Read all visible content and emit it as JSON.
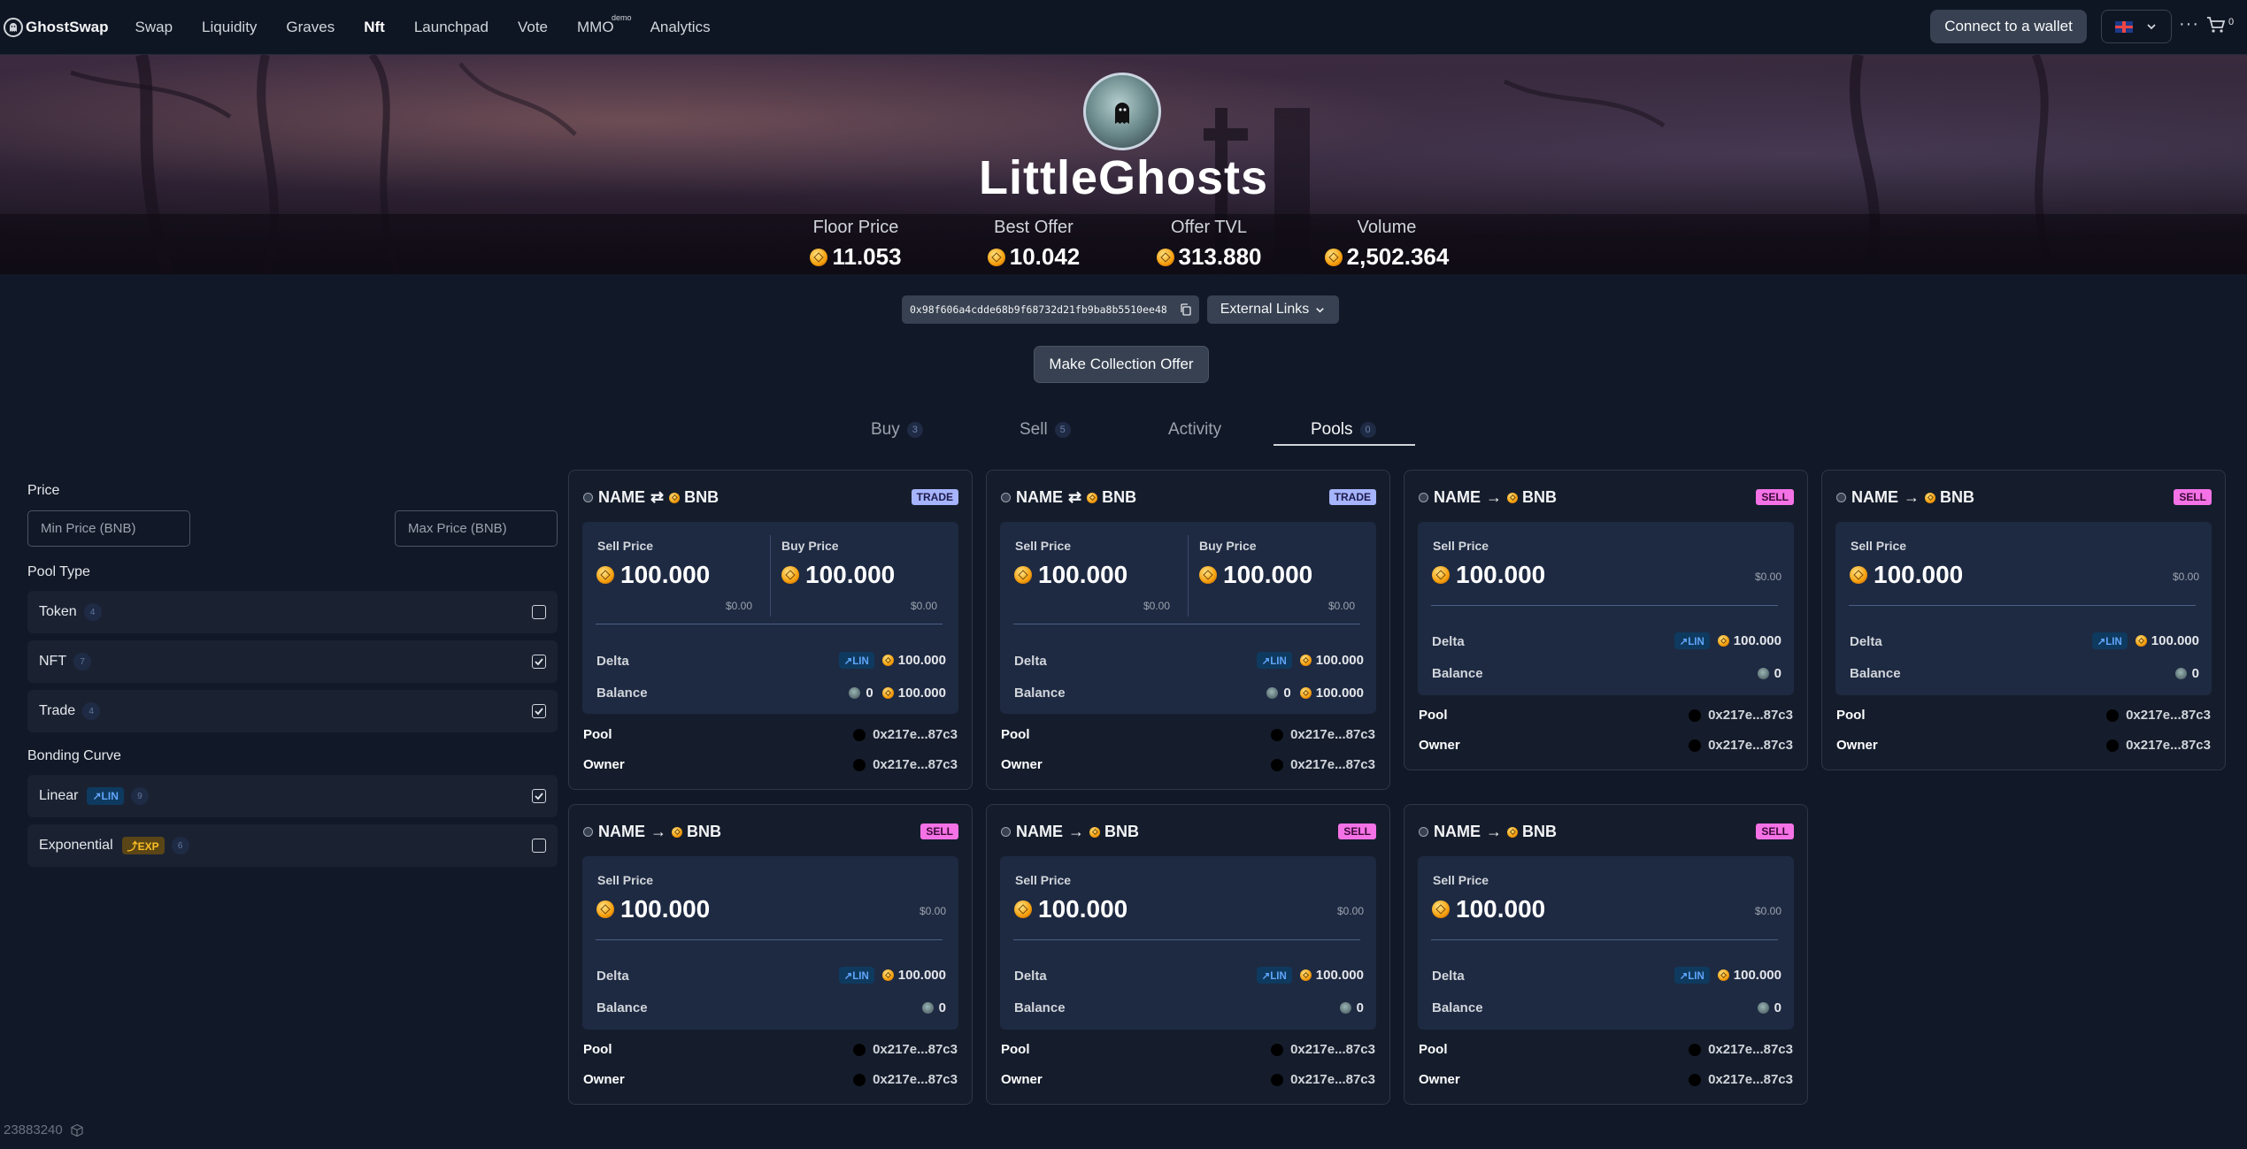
{
  "app": {
    "logo_text": "GhostSwap"
  },
  "nav": {
    "items": [
      {
        "label": "Swap",
        "active": false
      },
      {
        "label": "Liquidity",
        "active": false
      },
      {
        "label": "Graves",
        "active": false
      },
      {
        "label": "Nft",
        "active": true
      },
      {
        "label": "Launchpad",
        "active": false
      },
      {
        "label": "Vote",
        "active": false
      },
      {
        "label": "MMO",
        "active": false,
        "sup": "demo"
      },
      {
        "label": "Analytics",
        "active": false
      }
    ],
    "connect_label": "Connect to a wallet",
    "more_label": "···",
    "cart_count": "0"
  },
  "collection": {
    "name": "LittleGhosts",
    "stats": [
      {
        "label": "Floor Price",
        "value": "11.053"
      },
      {
        "label": "Best Offer",
        "value": "10.042"
      },
      {
        "label": "Offer TVL",
        "value": "313.880"
      },
      {
        "label": "Volume",
        "value": "2,502.364"
      }
    ],
    "address": "0x98f606a4cdde68b9f68732d21fb9ba8b5510ee48",
    "external_links_label": "External Links",
    "offer_button_label": "Make Collection Offer"
  },
  "tabs": [
    {
      "label": "Buy",
      "count": "3"
    },
    {
      "label": "Sell",
      "count": "5"
    },
    {
      "label": "Activity",
      "count": ""
    },
    {
      "label": "Pools",
      "count": "0"
    }
  ],
  "filters": {
    "price_label": "Price",
    "min_placeholder": "Min Price (BNB)",
    "max_placeholder": "Max Price (BNB)",
    "pool_type_label": "Pool Type",
    "pool_types": [
      {
        "label": "Token",
        "count": "4",
        "checked": false
      },
      {
        "label": "NFT",
        "count": "7",
        "checked": true
      },
      {
        "label": "Trade",
        "count": "4",
        "checked": true
      }
    ],
    "bonding_label": "Bonding Curve",
    "curves": [
      {
        "label": "Linear",
        "badge": "↗LIN",
        "count": "9",
        "checked": true
      },
      {
        "label": "Exponential",
        "badge": "⤴EXP",
        "count": "6",
        "checked": false
      }
    ]
  },
  "card_text": {
    "name": "NAME",
    "token": "BNB",
    "sell_price_label": "Sell Price",
    "buy_price_label": "Buy Price",
    "delta_label": "Delta",
    "balance_label": "Balance",
    "pool_label": "Pool",
    "owner_label": "Owner",
    "lin_badge": "↗LIN"
  },
  "pools": [
    {
      "type": "TRADE",
      "arrow": "⇄",
      "sell_price": "100.000",
      "sell_usd": "$0.00",
      "buy_price": "100.000",
      "buy_usd": "$0.00",
      "delta": "100.000",
      "balance_nft": "0",
      "balance_token": "100.000",
      "pool": "0x217e...87c3",
      "owner": "0x217e...87c3"
    },
    {
      "type": "TRADE",
      "arrow": "⇄",
      "sell_price": "100.000",
      "sell_usd": "$0.00",
      "buy_price": "100.000",
      "buy_usd": "$0.00",
      "delta": "100.000",
      "balance_nft": "0",
      "balance_token": "100.000",
      "pool": "0x217e...87c3",
      "owner": "0x217e...87c3"
    },
    {
      "type": "SELL",
      "arrow": "→",
      "sell_price": "100.000",
      "sell_usd": "$0.00",
      "delta": "100.000",
      "balance_nft": "0",
      "pool": "0x217e...87c3",
      "owner": "0x217e...87c3"
    },
    {
      "type": "SELL",
      "arrow": "→",
      "sell_price": "100.000",
      "sell_usd": "$0.00",
      "delta": "100.000",
      "balance_nft": "0",
      "pool": "0x217e...87c3",
      "owner": "0x217e...87c3"
    },
    {
      "type": "SELL",
      "arrow": "→",
      "sell_price": "100.000",
      "sell_usd": "$0.00",
      "delta": "100.000",
      "balance_nft": "0",
      "pool": "0x217e...87c3",
      "owner": "0x217e...87c3"
    },
    {
      "type": "SELL",
      "arrow": "→",
      "sell_price": "100.000",
      "sell_usd": "$0.00",
      "delta": "100.000",
      "balance_nft": "0",
      "pool": "0x217e...87c3",
      "owner": "0x217e...87c3"
    },
    {
      "type": "SELL",
      "arrow": "→",
      "sell_price": "100.000",
      "sell_usd": "$0.00",
      "delta": "100.000",
      "balance_nft": "0",
      "pool": "0x217e...87c3",
      "owner": "0x217e...87c3"
    }
  ],
  "footer": {
    "block_number": "23883240"
  },
  "icons": {
    "logo": "ghostswap-logo-icon",
    "flag": "uk-flag-icon",
    "cart": "cart-icon",
    "copy": "copy-icon",
    "chevron": "chevron-down-icon",
    "coin": "bnb-coin-icon",
    "nft": "nft-token-icon",
    "owner": "owner-avatar-icon",
    "check": "check-icon",
    "block": "block-cube-icon"
  },
  "colors": {
    "background": "#111827",
    "trade_badge": "#a5b4fc",
    "sell_badge": "#f472e6",
    "lin_badge": "#60a5fa",
    "exp_badge": "#fbbf24",
    "coin": "#f59e0b"
  }
}
